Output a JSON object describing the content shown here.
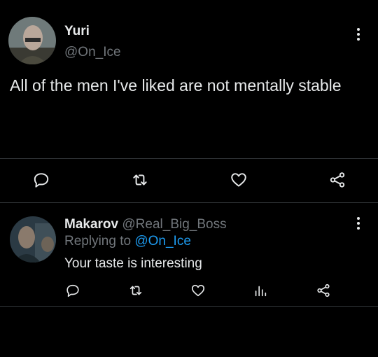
{
  "tweet": {
    "display_name": "Yuri",
    "handle": "@On_Ice",
    "text": "All of the men I've liked are not mentally stable",
    "actions": [
      "reply-icon",
      "retweet-icon",
      "like-icon",
      "share-icon"
    ],
    "more_icon": "more-vertical-icon"
  },
  "reply": {
    "display_name": "Makarov",
    "handle": "@Real_Big_Boss",
    "replying_prefix": "Replying to",
    "replying_handle": "@On_Ice",
    "text": "Your taste is interesting",
    "actions": [
      "reply-icon",
      "retweet-icon",
      "like-icon",
      "analytics-icon",
      "share-icon"
    ],
    "more_icon": "more-vertical-icon"
  },
  "colors": {
    "background": "#000000",
    "text": "#e7e9ea",
    "muted": "#71767b",
    "link": "#1d9bf0",
    "divider": "#2f3336"
  }
}
